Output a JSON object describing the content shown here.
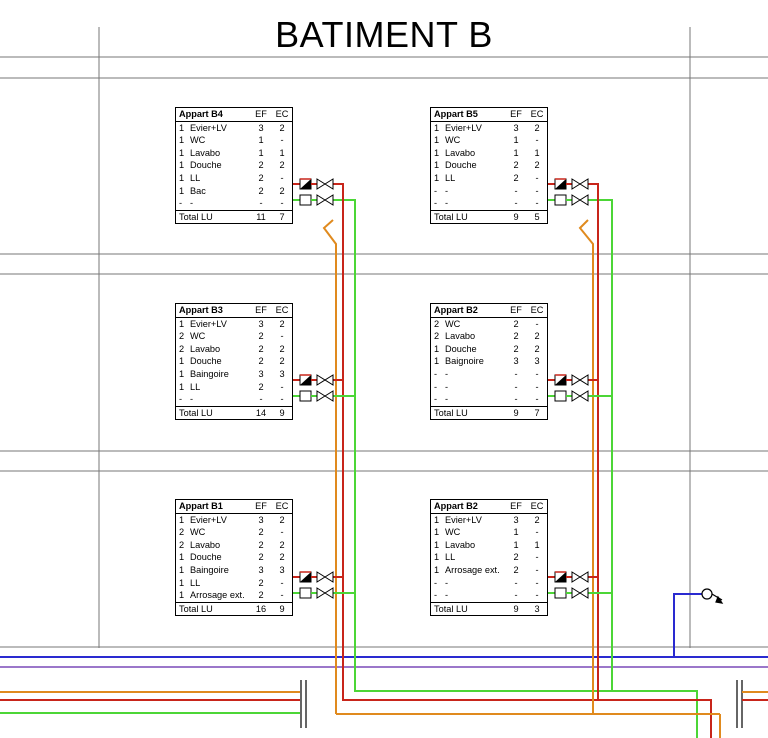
{
  "title": "BATIMENT B",
  "colors": {
    "cold_water": "#4cd636",
    "hot_water": "#c8251a",
    "return": "#e08a1e",
    "supply_main": "#2a2ad0",
    "grid": "#777777"
  },
  "icons": [
    "valve-icon",
    "meter-icon",
    "tap-icon",
    "union-icon"
  ],
  "tables": [
    {
      "id": "b4",
      "headers": [
        "Appart B4",
        "EF",
        "EC"
      ],
      "rows": [
        [
          "1",
          "Evier+LV",
          "3",
          "2"
        ],
        [
          "1",
          "WC",
          "1",
          "-"
        ],
        [
          "1",
          "Lavabo",
          "1",
          "1"
        ],
        [
          "1",
          "Douche",
          "2",
          "2"
        ],
        [
          "1",
          "LL",
          "2",
          "-"
        ],
        [
          "1",
          "Bac",
          "2",
          "2"
        ],
        [
          "-",
          "-",
          "-",
          "-"
        ]
      ],
      "total": [
        "Total LU",
        "11",
        "7"
      ]
    },
    {
      "id": "b5",
      "headers": [
        "Appart B5",
        "EF",
        "EC"
      ],
      "rows": [
        [
          "1",
          "Evier+LV",
          "3",
          "2"
        ],
        [
          "1",
          "WC",
          "1",
          "-"
        ],
        [
          "1",
          "Lavabo",
          "1",
          "1"
        ],
        [
          "1",
          "Douche",
          "2",
          "2"
        ],
        [
          "1",
          "LL",
          "2",
          "-"
        ],
        [
          "-",
          "-",
          "-",
          "-"
        ],
        [
          "-",
          "-",
          "-",
          "-"
        ]
      ],
      "total": [
        "Total LU",
        "9",
        "5"
      ]
    },
    {
      "id": "b3",
      "headers": [
        "Appart B3",
        "EF",
        "EC"
      ],
      "rows": [
        [
          "1",
          "Evier+LV",
          "3",
          "2"
        ],
        [
          "2",
          "WC",
          "2",
          "-"
        ],
        [
          "2",
          "Lavabo",
          "2",
          "2"
        ],
        [
          "1",
          "Douche",
          "2",
          "2"
        ],
        [
          "1",
          "Baingoire",
          "3",
          "3"
        ],
        [
          "1",
          "LL",
          "2",
          "-"
        ],
        [
          "-",
          "-",
          "-",
          "-"
        ]
      ],
      "total": [
        "Total LU",
        "14",
        "9"
      ]
    },
    {
      "id": "b2a",
      "headers": [
        "Appart B2",
        "EF",
        "EC"
      ],
      "rows": [
        [
          "2",
          "WC",
          "2",
          "-"
        ],
        [
          "2",
          "Lavabo",
          "2",
          "2"
        ],
        [
          "1",
          "Douche",
          "2",
          "2"
        ],
        [
          "1",
          "Baignoire",
          "3",
          "3"
        ],
        [
          "-",
          "-",
          "-",
          "-"
        ],
        [
          "-",
          "-",
          "-",
          "-"
        ],
        [
          "-",
          "-",
          "-",
          "-"
        ]
      ],
      "total": [
        "Total LU",
        "9",
        "7"
      ]
    },
    {
      "id": "b1",
      "headers": [
        "Appart B1",
        "EF",
        "EC"
      ],
      "rows": [
        [
          "1",
          "Evier+LV",
          "3",
          "2"
        ],
        [
          "2",
          "WC",
          "2",
          "-"
        ],
        [
          "2",
          "Lavabo",
          "2",
          "2"
        ],
        [
          "1",
          "Douche",
          "2",
          "2"
        ],
        [
          "1",
          "Baingoire",
          "3",
          "3"
        ],
        [
          "1",
          "LL",
          "2",
          "-"
        ],
        [
          "1",
          "Arrosage ext.",
          "2",
          "-"
        ]
      ],
      "total": [
        "Total LU",
        "16",
        "9"
      ]
    },
    {
      "id": "b2b",
      "headers": [
        "Appart B2",
        "EF",
        "EC"
      ],
      "rows": [
        [
          "1",
          "Evier+LV",
          "3",
          "2"
        ],
        [
          "1",
          "WC",
          "1",
          "-"
        ],
        [
          "1",
          "Lavabo",
          "1",
          "1"
        ],
        [
          "1",
          "LL",
          "2",
          "-"
        ],
        [
          "1",
          "Arrosage ext.",
          "2",
          "-"
        ],
        [
          "-",
          "-",
          "-",
          "-"
        ],
        [
          "-",
          "-",
          "-",
          "-"
        ]
      ],
      "total": [
        "Total LU",
        "9",
        "3"
      ]
    }
  ]
}
